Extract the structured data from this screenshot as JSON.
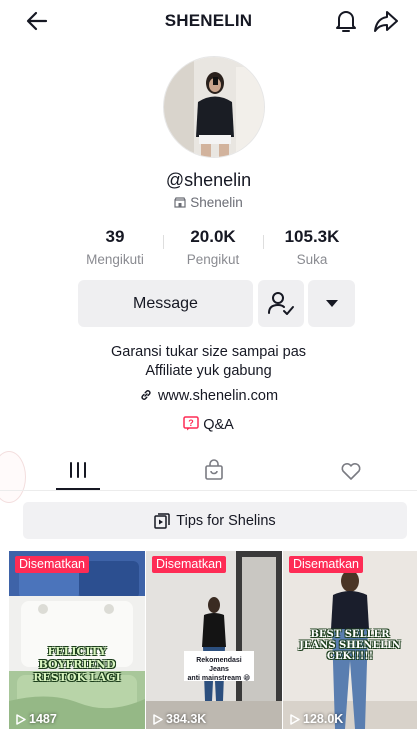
{
  "header": {
    "title": "SHENELIN",
    "back_icon": "arrow-left-icon",
    "bell_icon": "bell-icon",
    "share_icon": "share-arrow-icon"
  },
  "profile": {
    "username": "@shenelin",
    "display_name": "Shenelin"
  },
  "stats": [
    {
      "value": "39",
      "label": "Mengikuti"
    },
    {
      "value": "20.0K",
      "label": "Pengikut"
    },
    {
      "value": "105.3K",
      "label": "Suka"
    }
  ],
  "actions": {
    "message_label": "Message"
  },
  "bio": {
    "line1": "Garansi tukar size sampai pas",
    "line2": "Affiliate yuk gabung",
    "link": "www.shenelin.com",
    "qa": "Q&A"
  },
  "tabs": {
    "icons": [
      "grid-icon",
      "shop-bag-icon",
      "heart-icon"
    ],
    "active": 0
  },
  "tips": {
    "label": "Tips for Shelins"
  },
  "videos": [
    {
      "pin_label": "Disematkan",
      "views": "1487",
      "overlay_lines": [
        "FELICITY BOYFRIEND",
        "RESTOK LAGI"
      ]
    },
    {
      "pin_label": "Disematkan",
      "views": "384.3K",
      "overlay_lines": [
        "Rekomendasi Jeans",
        "anti mainstream 😁"
      ]
    },
    {
      "pin_label": "Disematkan",
      "views": "128.0K",
      "overlay_lines": [
        "BEST SELLER",
        "JEANS SHENELIN",
        "CEK!!!!!"
      ]
    }
  ],
  "colors": {
    "accent": "#fe2c55",
    "text": "#161823",
    "muted": "#8a8b91",
    "button_bg": "#efeff1"
  }
}
